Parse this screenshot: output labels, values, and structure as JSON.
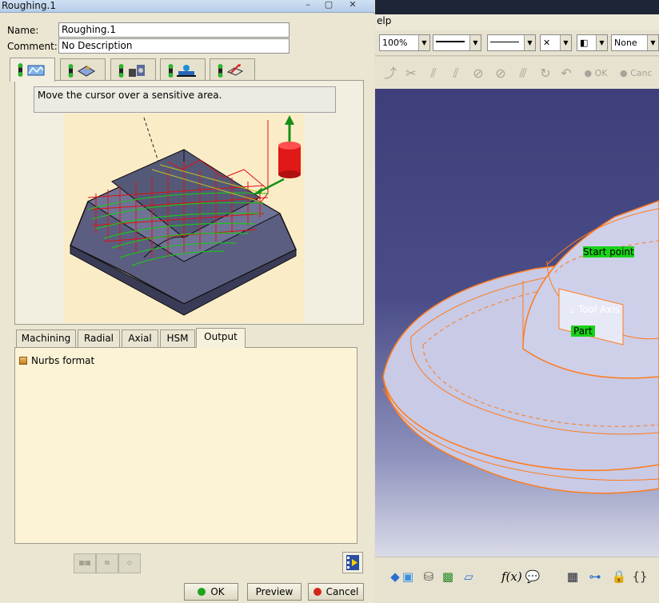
{
  "dialog": {
    "title": "Roughing.1",
    "name_label": "Name:",
    "name_value": "Roughing.1",
    "comment_label": "Comment:",
    "comment_value": "No Description",
    "hint_text": "Move the cursor over a sensitive area.",
    "sub_tabs": [
      "Machining",
      "Radial",
      "Axial",
      "HSM",
      "Output"
    ],
    "output_option": "Nurbs format",
    "buttons": {
      "ok": "OK",
      "preview": "Preview",
      "cancel": "Cancel"
    },
    "colors": {
      "ok_dot": "#1fa31f",
      "cancel_dot": "#d0261a",
      "part": "#585c7e",
      "toolpath_red": "#e01010",
      "toolpath_green": "#20c020"
    }
  },
  "app": {
    "menu_fragment": "elp",
    "zoom": "100%",
    "layer": "None",
    "ok_fragment": "OK",
    "cancel_fragment": "Canc",
    "viewport_labels": {
      "start_point": "Start point",
      "tool_axis": "Tool Axis",
      "part": "Part"
    },
    "colors": {
      "viewport_bg": "#42447f",
      "part_fill": "#c9cbe6",
      "edge": "#ff7a1a",
      "label_bg": "#19d219"
    }
  }
}
